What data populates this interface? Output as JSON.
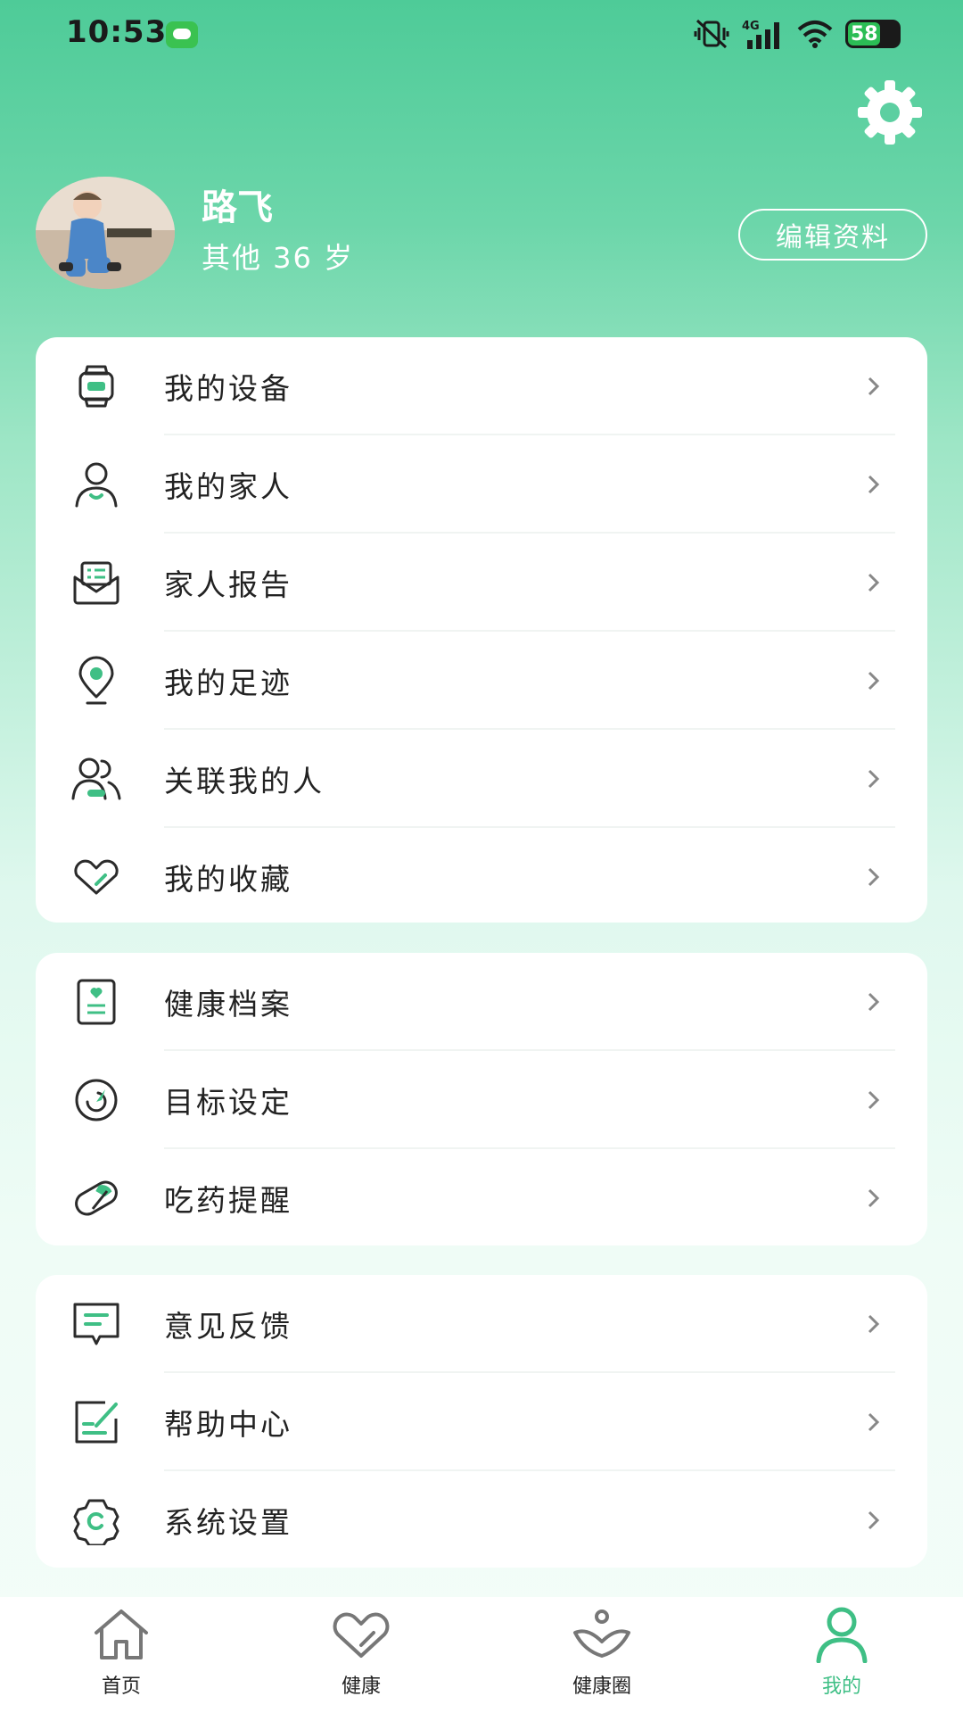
{
  "status_bar": {
    "time": "10:53",
    "battery": "58",
    "network": "4G"
  },
  "profile": {
    "name": "路飞",
    "info": "其他 36 岁",
    "edit_label": "编辑资料"
  },
  "groups": [
    {
      "items": [
        {
          "label": "我的设备",
          "icon": "watch-icon"
        },
        {
          "label": "我的家人",
          "icon": "person-heart-icon"
        },
        {
          "label": "家人报告",
          "icon": "envelope-report-icon"
        },
        {
          "label": "我的足迹",
          "icon": "location-pin-icon"
        },
        {
          "label": "关联我的人",
          "icon": "people-link-icon"
        },
        {
          "label": "我的收藏",
          "icon": "heart-icon"
        }
      ]
    },
    {
      "items": [
        {
          "label": "健康档案",
          "icon": "health-record-icon"
        },
        {
          "label": "目标设定",
          "icon": "target-icon"
        },
        {
          "label": "吃药提醒",
          "icon": "pill-icon"
        }
      ]
    },
    {
      "items": [
        {
          "label": "意见反馈",
          "icon": "feedback-icon"
        },
        {
          "label": "帮助中心",
          "icon": "help-edit-icon"
        },
        {
          "label": "系统设置",
          "icon": "settings-icon"
        }
      ]
    }
  ],
  "tabbar": {
    "tabs": [
      {
        "label": "首页",
        "icon": "home-icon"
      },
      {
        "label": "健康",
        "icon": "health-heart-icon"
      },
      {
        "label": "健康圈",
        "icon": "community-icon"
      },
      {
        "label": "我的",
        "icon": "person-icon"
      }
    ],
    "active": 3
  },
  "colors": {
    "accent": "#3fbf85",
    "icon_stroke": "#2b2b2b",
    "header_top": "#4ecb98"
  }
}
